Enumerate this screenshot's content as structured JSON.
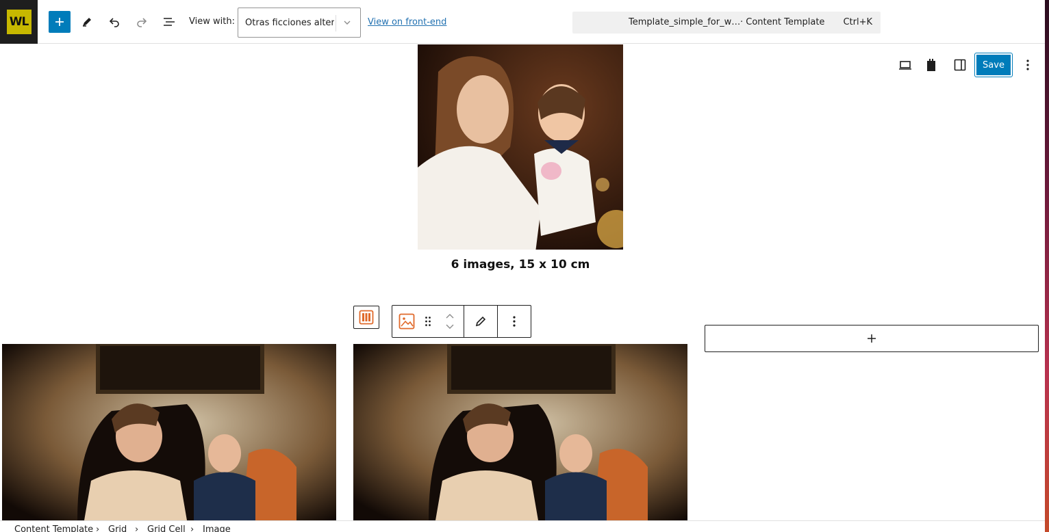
{
  "window": {
    "title": "Template_simple_for_w... · Content Template"
  },
  "topbar": {
    "logo_text": "WL",
    "add_label": "Add block",
    "view_with_label": "View with:",
    "view_select_value": "Otras ficciones alter…",
    "front_end_link": "View on front-end"
  },
  "command_bar": {
    "title": "Template_simple_for_w…",
    "type": "· Content Template",
    "shortcut": "Ctrl+K"
  },
  "secondary_toolbar": {
    "save_label": "Save"
  },
  "content": {
    "caption": "6 images, 15 x 10 cm"
  },
  "breadcrumb": {
    "items": [
      "Content Template",
      "Grid",
      "Grid Cell",
      "Image"
    ]
  },
  "colors": {
    "accent": "#007cba",
    "link": "#2271b1",
    "logo_bg": "#1e1e1e",
    "logo_fg": "#c7b800",
    "block_icon": "#e0692a"
  }
}
